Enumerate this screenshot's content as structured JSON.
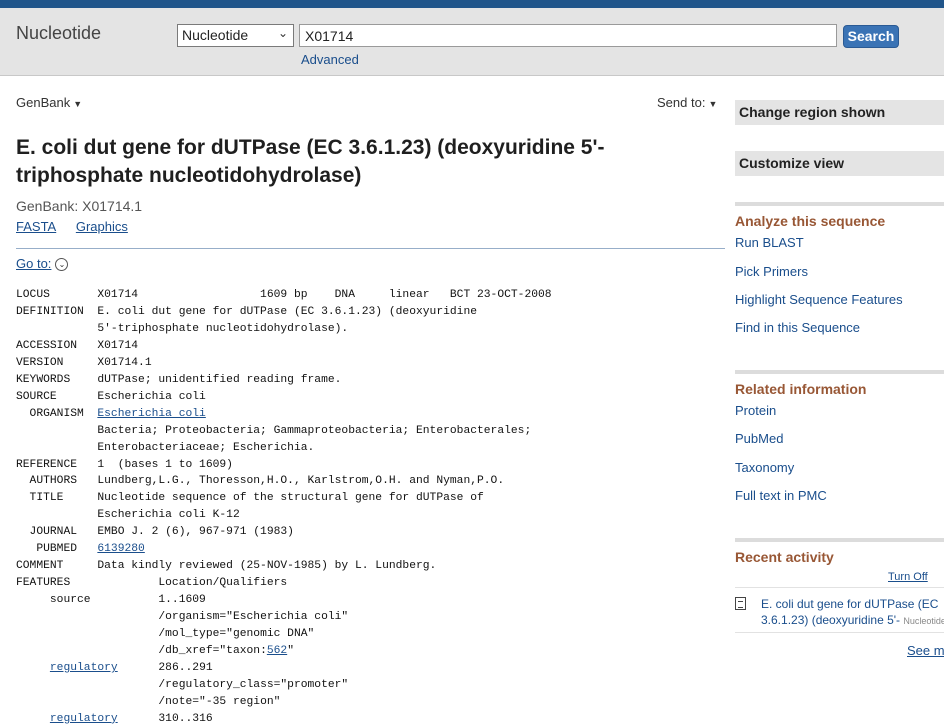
{
  "header": {
    "db_title": "Nucleotide",
    "db_select": "Nucleotide",
    "search_value": "X01714",
    "search_button": "Search",
    "advanced_link": "Advanced"
  },
  "record": {
    "format_menu": "GenBank",
    "send_to": "Send to:",
    "title": "E. coli dut gene for dUTPase (EC 3.6.1.23) (deoxyuridine 5'-triphosphate nucleotidohydrolase)",
    "accession_line": "GenBank: X01714.1",
    "views": [
      "FASTA",
      "Graphics"
    ],
    "goto": "Go to:"
  },
  "genbank_rows": [
    {
      "key": "LOCUS       ",
      "text": "X01714                  1609 bp    DNA     linear   BCT 23-OCT-2008"
    },
    {
      "key": "DEFINITION  ",
      "text": "E. coli dut gene for dUTPase (EC 3.6.1.23) (deoxyuridine"
    },
    {
      "key": "            ",
      "text": "5'-triphosphate nucleotidohydrolase)."
    },
    {
      "key": "ACCESSION   ",
      "text": "X01714"
    },
    {
      "key": "VERSION     ",
      "text": "X01714.1"
    },
    {
      "key": "KEYWORDS    ",
      "text": "dUTPase; unidentified reading frame."
    },
    {
      "key": "SOURCE      ",
      "text": "Escherichia coli"
    },
    {
      "key": "  ORGANISM  ",
      "link": "Escherichia coli"
    },
    {
      "key": "            ",
      "text": "Bacteria; Proteobacteria; Gammaproteobacteria; Enterobacterales;"
    },
    {
      "key": "            ",
      "text": "Enterobacteriaceae; Escherichia."
    },
    {
      "key": "REFERENCE   ",
      "text": "1  (bases 1 to 1609)"
    },
    {
      "key": "  AUTHORS   ",
      "text": "Lundberg,L.G., Thoresson,H.O., Karlstrom,O.H. and Nyman,P.O."
    },
    {
      "key": "  TITLE     ",
      "text": "Nucleotide sequence of the structural gene for dUTPase of"
    },
    {
      "key": "            ",
      "text": "Escherichia coli K-12"
    },
    {
      "key": "  JOURNAL   ",
      "text": "EMBO J. 2 (6), 967-971 (1983)"
    },
    {
      "key": "   PUBMED   ",
      "link": "6139280"
    },
    {
      "key": "COMMENT     ",
      "text": "Data kindly reviewed (25-NOV-1985) by L. Lundberg."
    },
    {
      "key": "FEATURES             ",
      "text": "Location/Qualifiers"
    },
    {
      "key": "     source          ",
      "text": "1..1609"
    },
    {
      "key": "                     ",
      "text": "/organism=\"Escherichia coli\""
    },
    {
      "key": "                     ",
      "text": "/mol_type=\"genomic DNA\""
    },
    {
      "key": "                     ",
      "text": "/db_xref=\"taxon:",
      "link": "562",
      "after": "\""
    },
    {
      "pre": "     ",
      "keylink": "regulatory",
      "key": "      ",
      "text": "286..291"
    },
    {
      "key": "                     ",
      "text": "/regulatory_class=\"promoter\""
    },
    {
      "key": "                     ",
      "text": "/note=\"-35 region\""
    },
    {
      "pre": "     ",
      "keylink": "regulatory",
      "key": "      ",
      "text": "310..316"
    }
  ],
  "sidebar": {
    "change_region": "Change region shown",
    "customize_view": "Customize view",
    "analyze_title": "Analyze this sequence",
    "analyze_links": [
      "Run BLAST",
      "Pick Primers",
      "Highlight Sequence Features",
      "Find in this Sequence"
    ],
    "related_title": "Related information",
    "related_links": [
      "Protein",
      "PubMed",
      "Taxonomy",
      "Full text in PMC"
    ],
    "recent_title": "Recent activity",
    "turn_off": "Turn Off",
    "recent_item_line1": "E. coli dut gene for dUTPase (EC",
    "recent_item_line2": "3.6.1.23) (deoxyuridine 5'-",
    "recent_item_sub": "Nucleotide",
    "see_more": "See more..."
  }
}
